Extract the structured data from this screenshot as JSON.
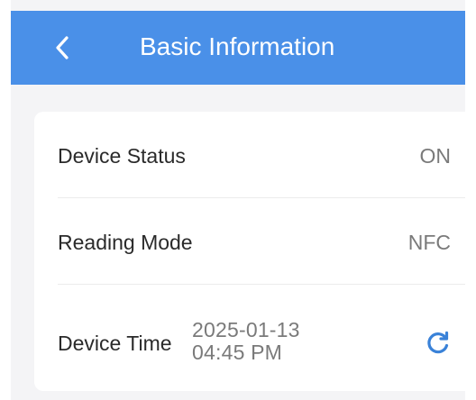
{
  "header": {
    "title": "Basic Information",
    "back_icon": "chevron-left-icon"
  },
  "info": {
    "device_status": {
      "label": "Device Status",
      "value": "ON"
    },
    "reading_mode": {
      "label": "Reading Mode",
      "value": "NFC"
    },
    "device_time": {
      "label": "Device Time",
      "value": "2025-01-13 04:45 PM",
      "action_icon": "refresh-icon"
    }
  },
  "colors": {
    "header_bg": "#4a90e8",
    "accent": "#3a82d8",
    "page_bg": "#f4f4f6",
    "card_bg": "#ffffff"
  }
}
